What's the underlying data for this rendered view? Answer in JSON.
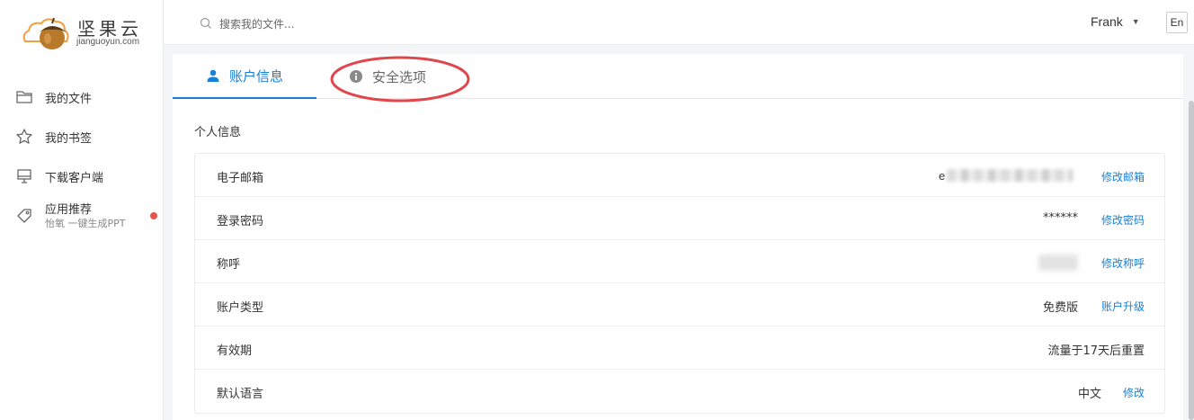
{
  "logo": {
    "title": "坚果云",
    "subtitle": "jianguoyun.com"
  },
  "sidebar": {
    "items": [
      {
        "label": "我的文件",
        "icon": "folder-icon"
      },
      {
        "label": "我的书签",
        "icon": "star-icon"
      },
      {
        "label": "下载客户端",
        "icon": "monitor-icon"
      },
      {
        "label": "应用推荐",
        "sub": "怡氧 一键生成PPT",
        "icon": "tag-icon"
      }
    ]
  },
  "topbar": {
    "search_placeholder": "搜索我的文件...",
    "user_name": "Frank",
    "lang_button": "En"
  },
  "tabs": {
    "account": "账户信息",
    "security": "安全选项"
  },
  "section_title": "个人信息",
  "rows": [
    {
      "key": "电子邮箱",
      "value": "e",
      "action": "修改邮箱"
    },
    {
      "key": "登录密码",
      "value": "******",
      "action": "修改密码"
    },
    {
      "key": "称呼",
      "value": "",
      "action": "修改称呼"
    },
    {
      "key": "账户类型",
      "value": "免费版",
      "action": "账户升级"
    },
    {
      "key": "有效期",
      "value": "流量于17天后重置",
      "action": ""
    },
    {
      "key": "默认语言",
      "value": "中文",
      "action": "修改"
    }
  ],
  "colors": {
    "accent": "#1a7fd6",
    "annotation": "#e0474c",
    "notify_dot": "#e9534f"
  }
}
